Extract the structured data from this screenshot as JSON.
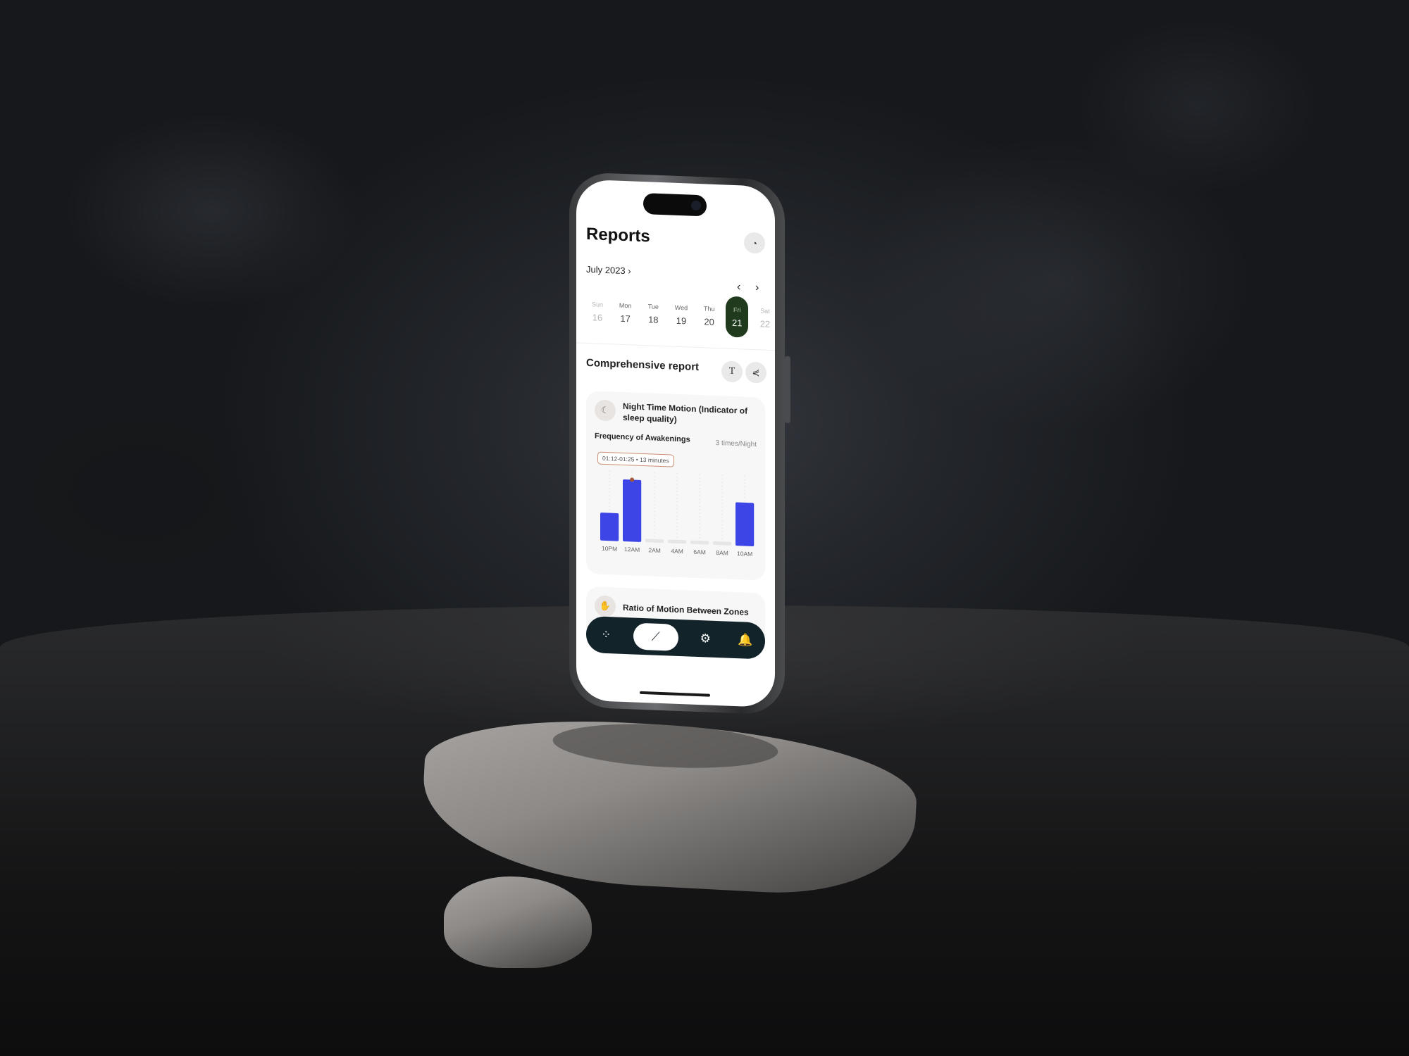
{
  "app": {
    "title": "Reports",
    "history_icon": "history-icon"
  },
  "calendar": {
    "month_label": "July 2023",
    "month_chevron": "›",
    "prev": "‹",
    "next": "›",
    "days": [
      {
        "name": "Sun",
        "num": "16",
        "state": "muted"
      },
      {
        "name": "Mon",
        "num": "17",
        "state": "normal"
      },
      {
        "name": "Tue",
        "num": "18",
        "state": "normal"
      },
      {
        "name": "Wed",
        "num": "19",
        "state": "normal"
      },
      {
        "name": "Thu",
        "num": "20",
        "state": "normal"
      },
      {
        "name": "Fri",
        "num": "21",
        "state": "active"
      },
      {
        "name": "Sat",
        "num": "22",
        "state": "muted"
      }
    ]
  },
  "report": {
    "section_title": "Comprehensive report",
    "text_button": "T",
    "share_icon": "share-icon"
  },
  "card1": {
    "title": "Night Time Motion (Indicator of sleep quality)",
    "metric_label": "Frequency of Awakenings",
    "metric_value": "3 times/Night",
    "tooltip": "01:12-01:25 • 13 minutes"
  },
  "card2": {
    "title": "Ratio of Motion Between Zones"
  },
  "tabbar": {
    "items": [
      {
        "icon": "grid-icon",
        "glyph": "⁘",
        "active": false
      },
      {
        "icon": "chart-icon",
        "glyph": "⟋",
        "active": true
      },
      {
        "icon": "gear-icon",
        "glyph": "⚙",
        "active": false
      },
      {
        "icon": "bell-icon",
        "glyph": "🔔",
        "active": false
      }
    ]
  },
  "colors": {
    "accent_bar": "#3d45e6",
    "inactive_bar": "#e6e6e6",
    "active_day": "#1f3a1c",
    "tabbar": "#13232a",
    "tooltip_border": "#c98e73"
  },
  "chart_data": {
    "type": "bar",
    "title": "Frequency of Awakenings",
    "categories": [
      "10PM",
      "12AM",
      "2AM",
      "4AM",
      "6AM",
      "8AM",
      "10AM"
    ],
    "values": [
      0.45,
      1.0,
      0,
      0,
      0,
      0,
      0.7
    ],
    "highlighted_index": 1,
    "ylim": [
      0,
      1
    ],
    "grid": "vertical-dashed"
  }
}
